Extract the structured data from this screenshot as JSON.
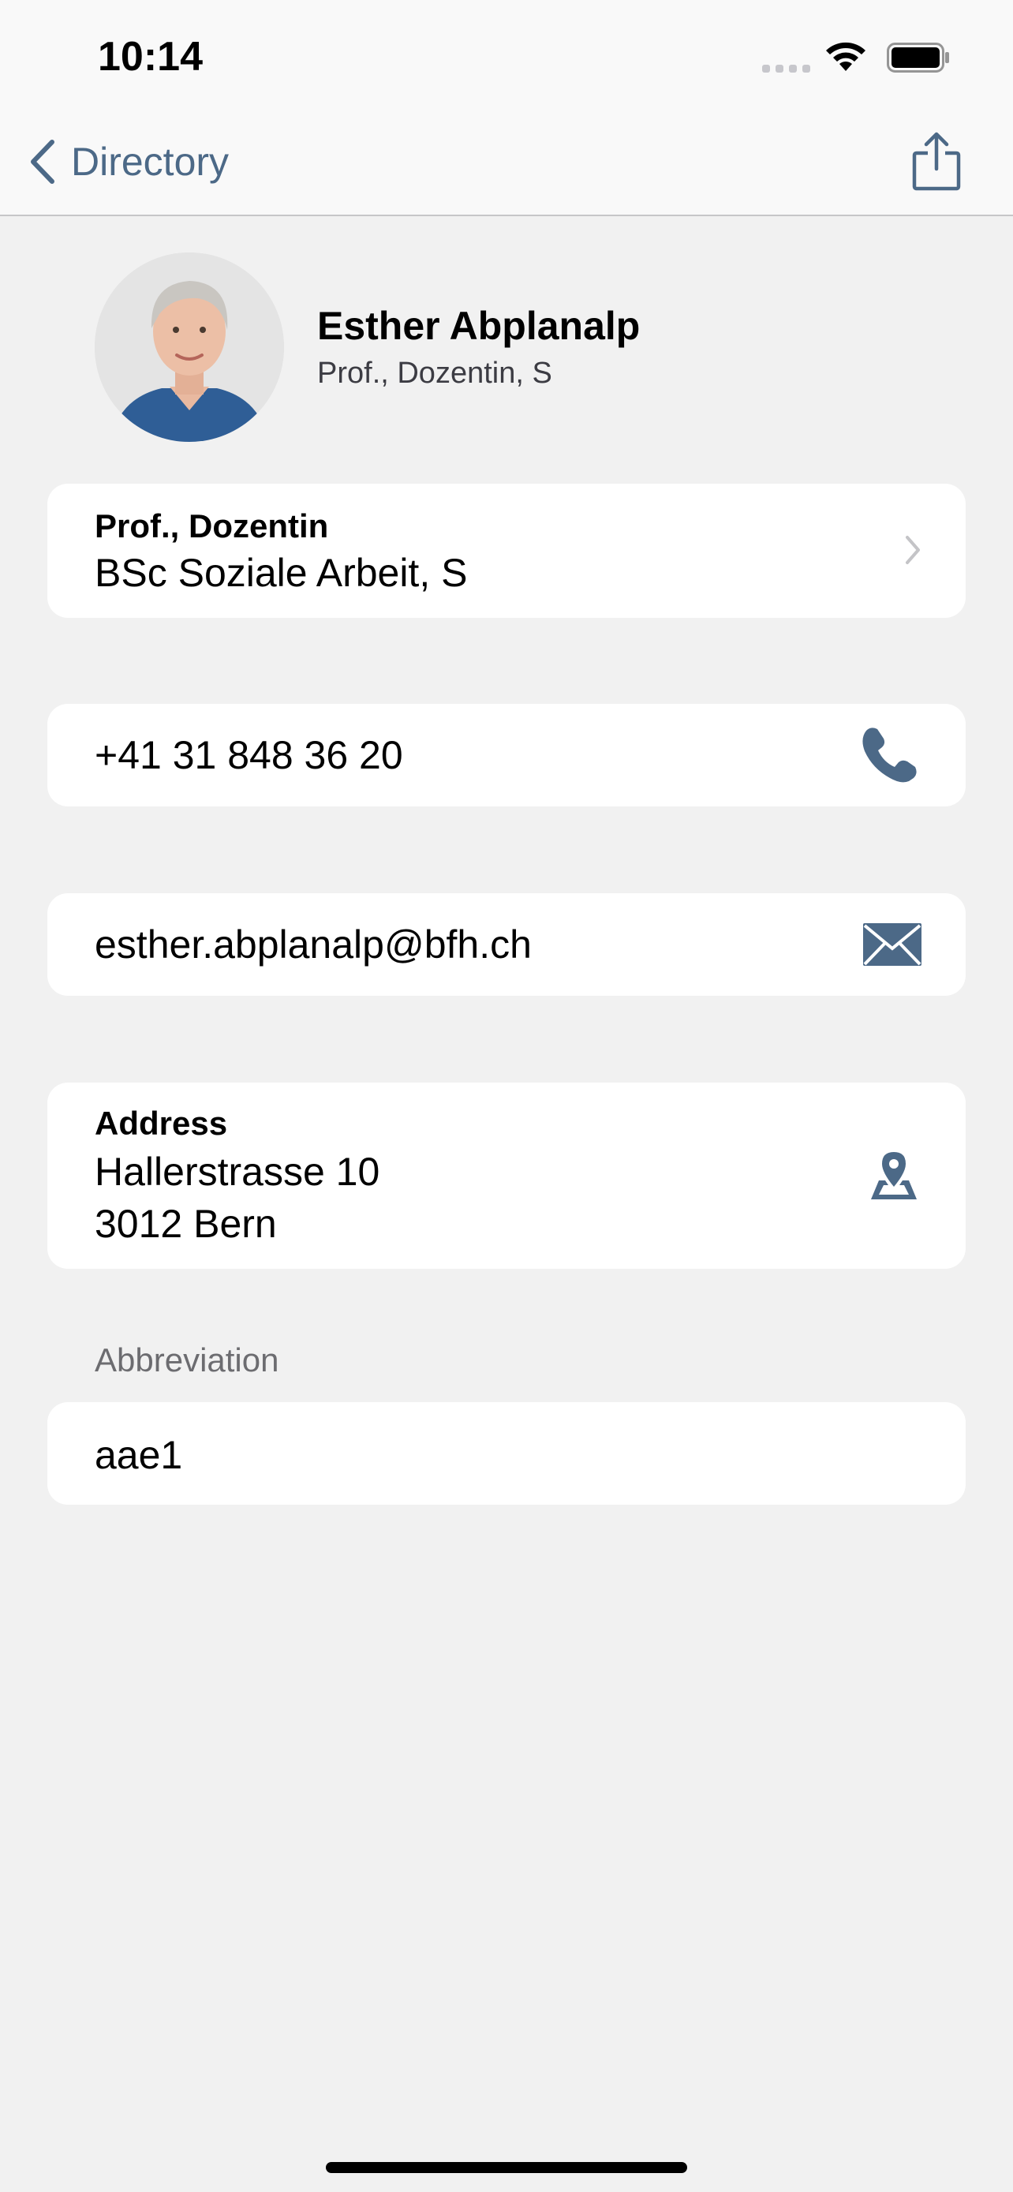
{
  "status_bar": {
    "time": "10:14"
  },
  "nav": {
    "back_label": "Directory",
    "back_icon": "chevron-left-icon",
    "share_icon": "share-icon",
    "accent_color": "#4c6987"
  },
  "profile": {
    "name": "Esther Abplanalp",
    "subtitle": "Prof., Dozentin, S"
  },
  "role_card": {
    "title": "Prof., Dozentin",
    "department": "BSc Soziale Arbeit, S"
  },
  "phone_card": {
    "number": "+41 31 848 36 20",
    "icon": "phone-icon"
  },
  "email_card": {
    "email": "esther.abplanalp@bfh.ch",
    "icon": "mail-icon"
  },
  "address_card": {
    "title": "Address",
    "street": "Hallerstrasse 10",
    "city": "3012 Bern",
    "icon": "map-pin-icon"
  },
  "abbreviation": {
    "header": "Abbreviation",
    "value": "aae1"
  }
}
